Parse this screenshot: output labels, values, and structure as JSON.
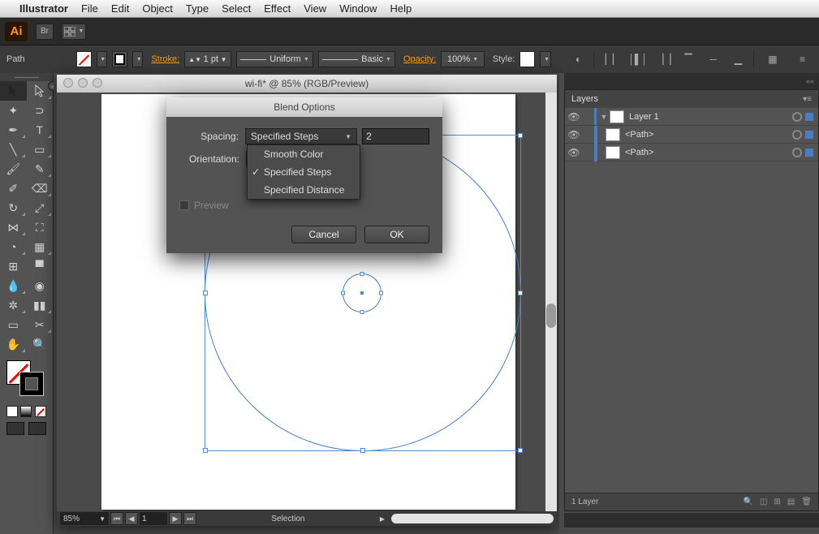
{
  "mac_menu": {
    "app_name": "Illustrator",
    "items": [
      "File",
      "Edit",
      "Object",
      "Type",
      "Select",
      "Effect",
      "View",
      "Window",
      "Help"
    ]
  },
  "app_bar": {
    "logo": "Ai",
    "br_label": "Br"
  },
  "control_bar": {
    "context_label": "Path",
    "stroke_label": "Stroke:",
    "stroke_value": "1 pt",
    "profile_label": "Uniform",
    "brush_label": "Basic",
    "opacity_label": "Opacity:",
    "opacity_value": "100%",
    "style_label": "Style:"
  },
  "document": {
    "title": "wi-fi* @ 85% (RGB/Preview)",
    "zoom": "85%",
    "page": "1",
    "status_mode": "Selection"
  },
  "dialog": {
    "title": "Blend Options",
    "spacing_label": "Spacing:",
    "spacing_value": "Specified Steps",
    "steps_value": "2",
    "orientation_label": "Orientation:",
    "preview_label": "Preview",
    "cancel": "Cancel",
    "ok": "OK",
    "options": {
      "smooth": "Smooth Color",
      "steps": "Specified Steps",
      "distance": "Specified Distance"
    }
  },
  "layers": {
    "title": "Layers",
    "footer": "1 Layer",
    "items": [
      {
        "name": "Layer 1",
        "expanded": true
      },
      {
        "name": "<Path>"
      },
      {
        "name": "<Path>"
      }
    ]
  }
}
